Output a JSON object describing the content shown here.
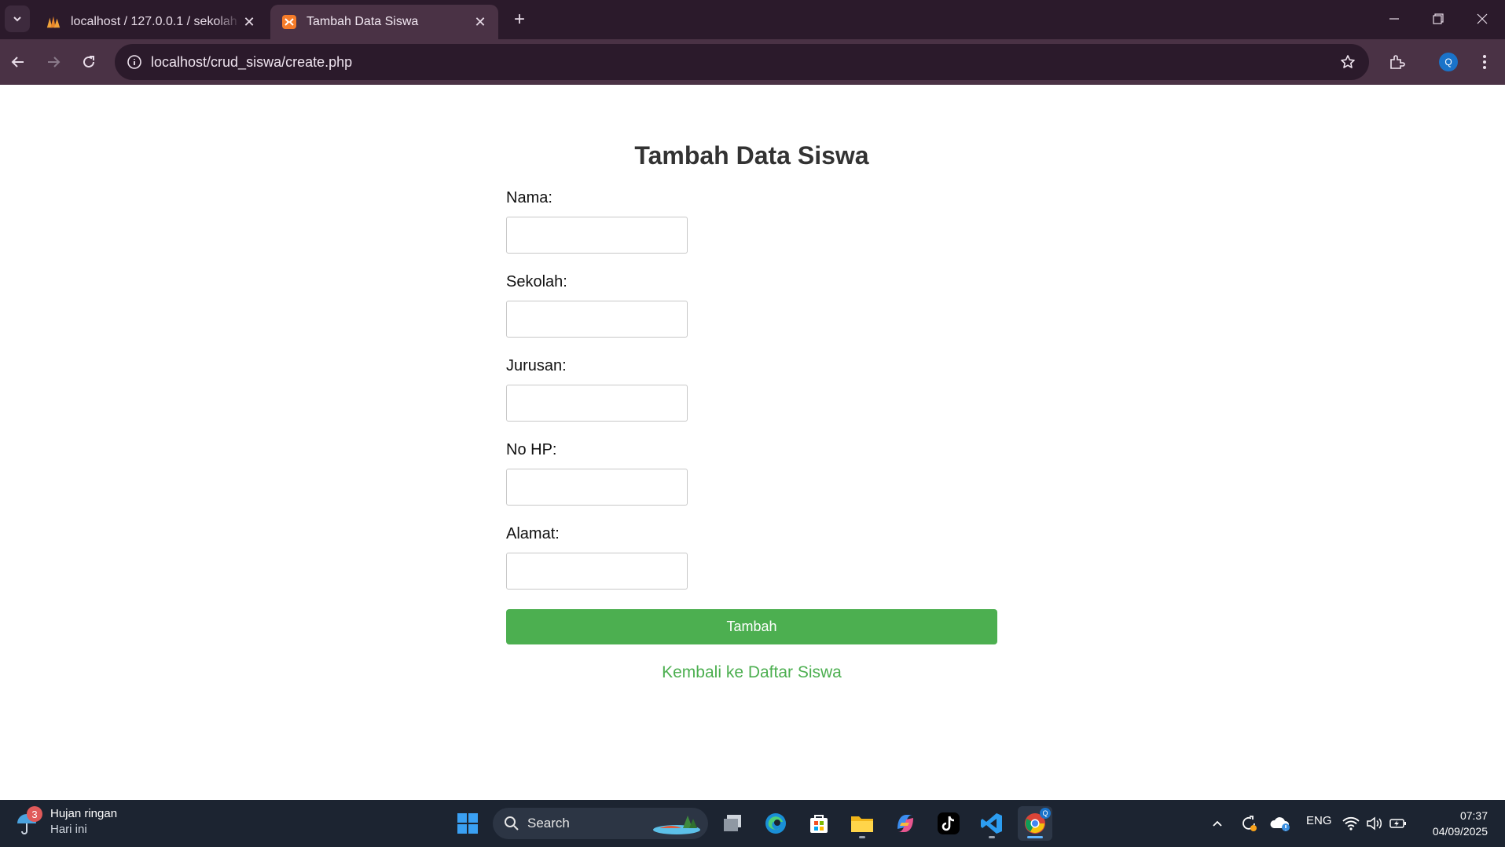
{
  "browser": {
    "tabs": [
      {
        "title": "localhost / 127.0.0.1 / sekolah /",
        "favicon": "phpmyadmin-icon",
        "active": false
      },
      {
        "title": "Tambah Data Siswa",
        "favicon": "xampp-icon",
        "active": true
      }
    ],
    "url": "localhost/crud_siswa/create.php",
    "profile_initial": "Q"
  },
  "page": {
    "title": "Tambah Data Siswa",
    "fields": [
      {
        "label": "Nama:",
        "value": ""
      },
      {
        "label": "Sekolah:",
        "value": ""
      },
      {
        "label": "Jurusan:",
        "value": ""
      },
      {
        "label": "No HP:",
        "value": ""
      },
      {
        "label": "Alamat:",
        "value": ""
      }
    ],
    "submit_label": "Tambah",
    "back_link": "Kembali ke Daftar Siswa",
    "colors": {
      "accent": "#4caf50",
      "title": "#333333"
    }
  },
  "taskbar": {
    "weather_badge": "3",
    "weather_title": "Hujan ringan",
    "weather_sub": "Hari ini",
    "search_label": "Search",
    "apps": [
      "windows-start-icon",
      "search-icon",
      "task-view-icon",
      "edge-icon",
      "store-icon",
      "file-explorer-icon",
      "copilot-icon",
      "tiktok-icon",
      "vscode-icon",
      "chrome-icon"
    ],
    "chrome_badge": "Q",
    "lang": "ENG",
    "time": "07:37",
    "date": "04/09/2025"
  }
}
